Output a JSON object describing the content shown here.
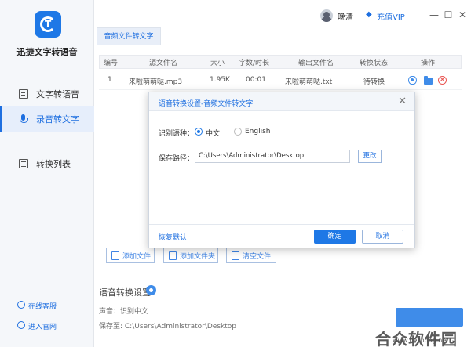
{
  "app": {
    "name": "迅捷文字转语音",
    "logo_letter": "T"
  },
  "sidebar": {
    "items": [
      {
        "label": "文字转语音",
        "icon": "document-icon",
        "active": false
      },
      {
        "label": "录音转文字",
        "icon": "microphone-icon",
        "active": true
      },
      {
        "label": "转换列表",
        "icon": "list-icon",
        "active": false
      }
    ],
    "links": [
      {
        "label": "在线客服",
        "icon": "headset-icon"
      },
      {
        "label": "进入官网",
        "icon": "globe-icon"
      }
    ]
  },
  "header": {
    "username": "晚清",
    "vip_label": "充值VIP",
    "vip_icon": "◆",
    "minimize": "—",
    "maximize": "☐",
    "close": "✕"
  },
  "tab": {
    "label": "音频文件转文字"
  },
  "table": {
    "headers": [
      "编号",
      "源文件名",
      "大小",
      "字数/时长",
      "输出文件名",
      "转换状态",
      "操作"
    ],
    "rows": [
      {
        "no": "1",
        "source": "来啦萌萌哒.mp3",
        "size": "1.95K",
        "duration": "00:01",
        "output": "来啦萌萌哒.txt",
        "status": "待转换"
      }
    ]
  },
  "bottom_buttons": {
    "add_file": "添加文件",
    "add_folder": "添加文件夹",
    "clear_files": "清空文件"
  },
  "settings": {
    "title": "语音转换设置",
    "voice_line": "声音：识别中文",
    "save_line": "保存至: C:\\Users\\Administrator\\Desktop"
  },
  "dialog": {
    "title": "语音转换设置-音频文件转文字",
    "language_label": "识别语种：",
    "lang_options": [
      "中文",
      "English"
    ],
    "selected_lang": "中文",
    "path_label": "保存路径：",
    "path_value": "C:\\Users\\Administrator\\Desktop",
    "change_label": "更改",
    "restore_label": "恢复默认",
    "ok_label": "确定",
    "cancel_label": "取消",
    "close_glyph": "✕"
  },
  "watermark": {
    "text": "合众软件园",
    "url": "www.hezhong.net"
  },
  "colors": {
    "accent": "#1e78e6",
    "sidebar_bg": "#f5f7fa",
    "delete": "#e53935"
  }
}
